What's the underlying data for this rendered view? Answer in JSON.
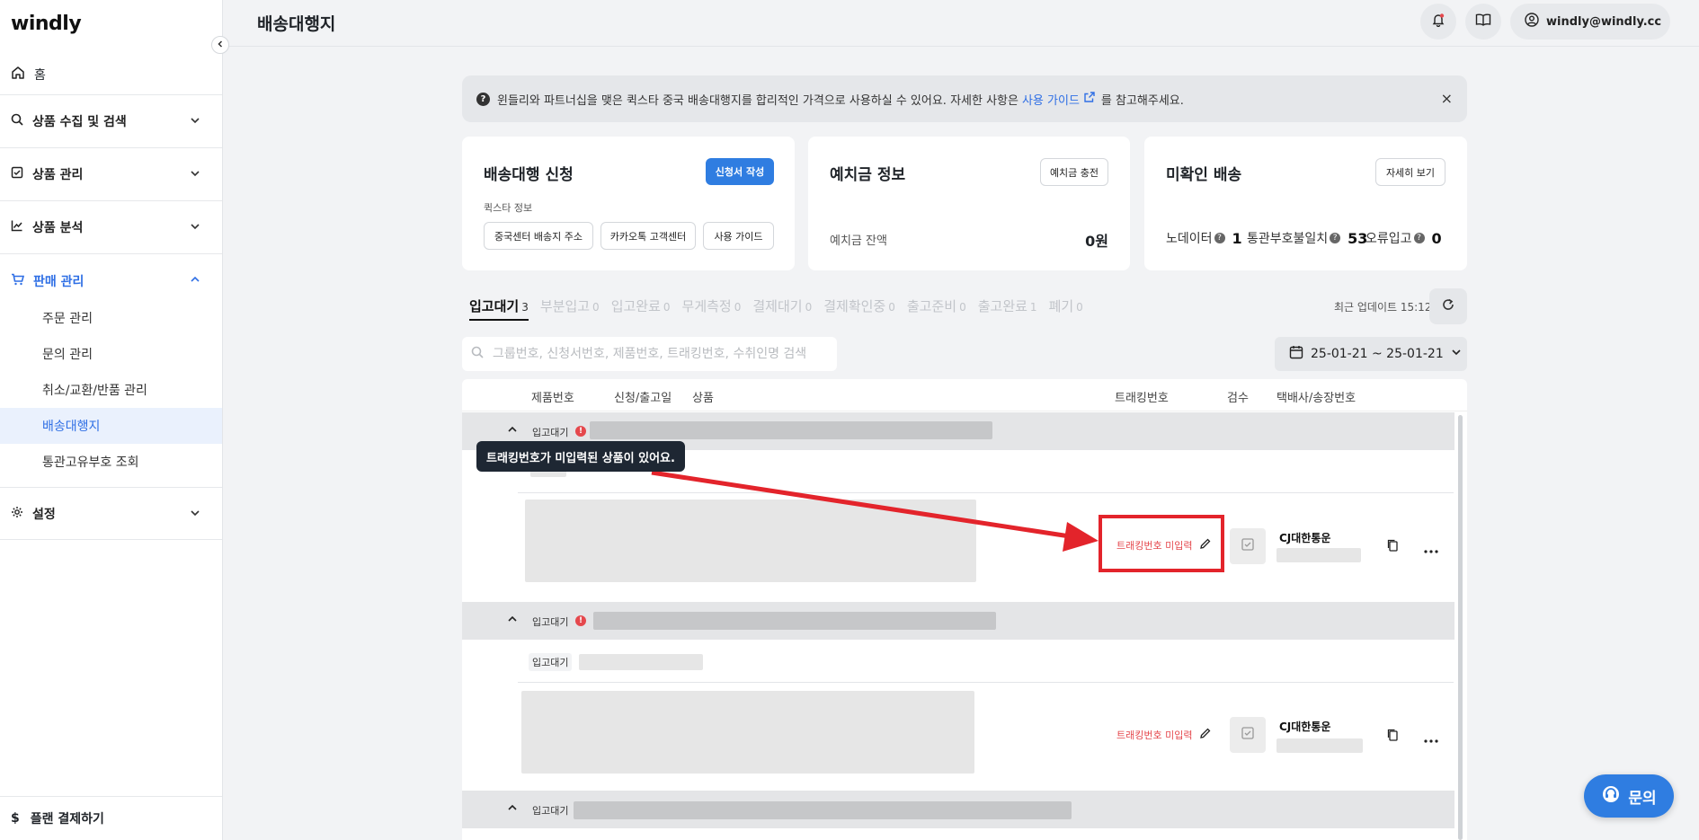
{
  "app": {
    "logo": "windly"
  },
  "sidebar": {
    "home": "홈",
    "groups": [
      {
        "label": "상품 수집 및 검색"
      },
      {
        "label": "상품 관리"
      },
      {
        "label": "상품 분석"
      },
      {
        "label": "판매 관리"
      },
      {
        "label": "설정"
      }
    ],
    "sales_items": [
      "주문 관리",
      "문의 관리",
      "취소/교환/반품 관리",
      "배송대행지",
      "통관고유부호 조회"
    ],
    "plan": "플랜 결제하기"
  },
  "header": {
    "title": "배송대행지",
    "user": "windly@windly.cc"
  },
  "notice": {
    "text_before": "윈들리와 파트너십을 맺은 퀵스타 중국 배송대행지를 합리적인 가격으로 사용하실 수 있어요. 자세한 사항은",
    "link": "사용 가이드",
    "text_after": "를 참고해주세요.",
    "close": "×"
  },
  "cards": {
    "apply": {
      "title": "배송대행 신청",
      "primary_button": "신청서 작성",
      "subtitle": "퀵스타 정보",
      "buttons": [
        "중국센터 배송지 주소",
        "카카오톡 고객센터",
        "사용 가이드"
      ]
    },
    "deposit": {
      "title": "예치금 정보",
      "button": "예치금 충전",
      "balance_label": "예치금 잔액",
      "balance_value": "0원"
    },
    "unconfirmed": {
      "title": "미확인 배송",
      "button": "자세히 보기",
      "stats": [
        {
          "label": "노데이터",
          "value": "1"
        },
        {
          "label": "통관부호불일치",
          "value": "53"
        },
        {
          "label": "오류입고",
          "value": "0"
        }
      ]
    }
  },
  "tabs": [
    {
      "label": "입고대기",
      "count": "3"
    },
    {
      "label": "부분입고",
      "count": "0"
    },
    {
      "label": "입고완료",
      "count": "0"
    },
    {
      "label": "무게측정",
      "count": "0"
    },
    {
      "label": "결제대기",
      "count": "0"
    },
    {
      "label": "결제확인중",
      "count": "0"
    },
    {
      "label": "출고준비",
      "count": "0"
    },
    {
      "label": "출고완료",
      "count": "1"
    },
    {
      "label": "폐기",
      "count": "0"
    }
  ],
  "updated": "최근 업데이트 15:12",
  "search": {
    "placeholder": "그룹번호, 신청서번호, 제품번호, 트래킹번호, 수취인명 검색"
  },
  "date_range": "25-01-21 ~ 25-01-21",
  "table": {
    "headers": {
      "product_no": "제품번호",
      "date": "신청/출고일",
      "product": "상품",
      "tracking": "트래킹번호",
      "inspect": "검수",
      "carrier": "택배사/송장번호"
    },
    "status_badge": "입고대기",
    "tracking_missing": "트래킹번호 미입력",
    "carrier_name": "CJ대한통운"
  },
  "tooltip": "트래킹번호가 미입력된 상품이 있어요.",
  "chat": {
    "label": "문의"
  },
  "colors": {
    "accent": "#2f7de1",
    "danger": "#e5484d",
    "annotation": "#e3242b"
  }
}
